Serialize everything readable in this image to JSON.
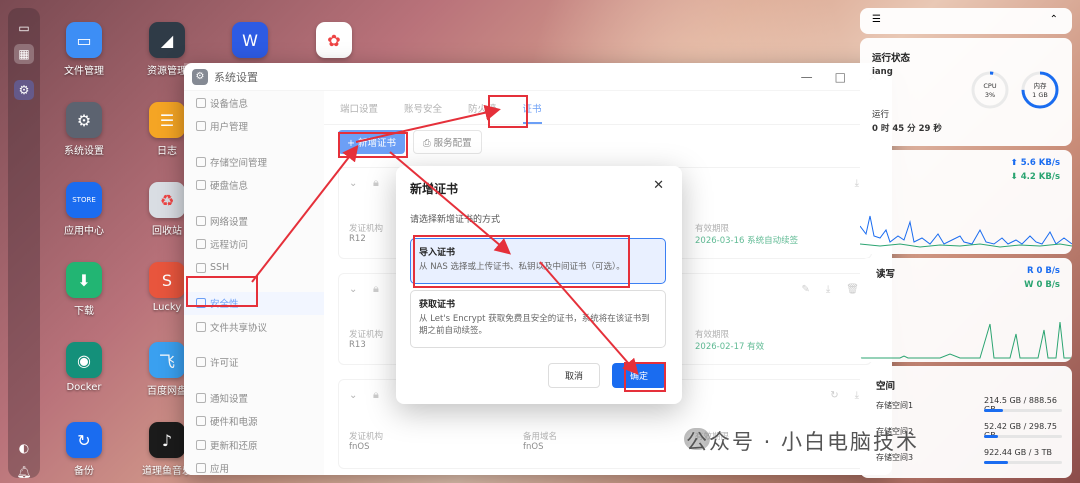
{
  "desktop": {
    "icons": [
      {
        "label": "文件管理",
        "glyph": "▭",
        "color": "#3d8ef5"
      },
      {
        "label": "资源管理",
        "glyph": "◢",
        "color": "#2f3b47"
      },
      {
        "label": "W",
        "glyph": "W",
        "color": "#2d5be3"
      },
      {
        "label": "",
        "glyph": "✿",
        "color": "#ffffff"
      },
      {
        "label": "系统设置",
        "glyph": "⚙",
        "color": "#5c6370"
      },
      {
        "label": "日志",
        "glyph": "☰",
        "color": "#f5a524"
      },
      {
        "label": "应用中心",
        "glyph": "STORE",
        "color": "#1a6cf0"
      },
      {
        "label": "回收站",
        "glyph": "♻",
        "color": "#d9dde3"
      },
      {
        "label": "下载",
        "glyph": "⬇",
        "color": "#22b573"
      },
      {
        "label": "Lucky",
        "glyph": "S",
        "color": "#e8553d"
      },
      {
        "label": "Docker",
        "glyph": "◉",
        "color": "#14907a"
      },
      {
        "label": "百度网盘",
        "glyph": "飞",
        "color": "#3aa0f0"
      },
      {
        "label": "备份",
        "glyph": "↻",
        "color": "#1a6cf0"
      },
      {
        "label": "道理鱼音乐",
        "glyph": "♪",
        "color": "#1b1b1b"
      }
    ]
  },
  "window": {
    "title": "系统设置",
    "controls": {
      "minimize": "—",
      "maximize": "□",
      "close": "✕"
    },
    "sidebar": [
      {
        "label": "设备信息",
        "icon": "device-icon"
      },
      {
        "label": "用户管理",
        "icon": "user-icon"
      },
      {
        "label": "存储空间管理",
        "icon": "storage-icon"
      },
      {
        "label": "硬盘信息",
        "icon": "disk-icon"
      },
      {
        "label": "网络设置",
        "icon": "network-icon"
      },
      {
        "label": "远程访问",
        "icon": "remote-icon"
      },
      {
        "label": "SSH",
        "icon": "ssh-icon"
      },
      {
        "label": "安全性",
        "icon": "shield-icon",
        "active": true
      },
      {
        "label": "文件共享协议",
        "icon": "share-icon"
      },
      {
        "label": "许可证",
        "icon": "license-icon"
      },
      {
        "label": "通知设置",
        "icon": "bell-icon"
      },
      {
        "label": "硬件和电源",
        "icon": "power-icon"
      },
      {
        "label": "更新和还原",
        "icon": "update-icon"
      },
      {
        "label": "应用",
        "icon": "app-icon"
      }
    ],
    "tabs": [
      "端口设置",
      "账号安全",
      "防火墙",
      "证书"
    ],
    "toolbar": {
      "add_cert": "+ 新增证书",
      "service_config": "服务配置"
    },
    "cards": [
      {
        "issuer_label": "发证机构",
        "issuer": "R12",
        "validity_label": "有效期限",
        "validity": "2026-03-16 系统自动续签"
      },
      {
        "issuer_label": "发证机构",
        "issuer": "R13",
        "validity_label": "有效期限",
        "validity": "2026-02-17 有效"
      },
      {
        "issuer_label": "发证机构",
        "issuer": "fnOS",
        "domain_label": "备用域名",
        "domain": "fnOS",
        "validity_label": "有效期限"
      }
    ]
  },
  "modal": {
    "title": "新增证书",
    "subtitle": "请选择新增证书的方式",
    "options": [
      {
        "title": "导入证书",
        "desc": "从 NAS 选择或上传证书、私钥以及中间证书（可选）。"
      },
      {
        "title": "获取证书",
        "desc": "从 Let's Encrypt 获取免费且安全的证书，系统将在该证书到期之前自动续签。"
      }
    ],
    "cancel": "取消",
    "confirm": "确定"
  },
  "panel": {
    "status": {
      "title": "运行状态",
      "host": "iang",
      "runtime_label": "运行",
      "runtime": "0 时 45 分 29 秒",
      "cpu_label": "CPU",
      "cpu_value": "3%",
      "cpu_percent": 3,
      "mem_label": "内存",
      "mem_value": "1 GB",
      "mem_percent": 75
    },
    "network": {
      "up": "⬆ 5.6 KB/s",
      "down": "⬇ 4.2 KB/s"
    },
    "disk_io": {
      "title": "读写",
      "read": "R 0 B/s",
      "write": "W 0 B/s"
    },
    "storage": {
      "title": "空间",
      "items": [
        {
          "name": "存储空间1",
          "usage": "214.5 GB / 888.56 GB",
          "fraction": 0.24
        },
        {
          "name": "存储空间2",
          "usage": "52.42 GB / 298.75 GB",
          "fraction": 0.18
        },
        {
          "name": "存储空间3",
          "usage": "922.44 GB / 3 TB",
          "fraction": 0.31
        }
      ]
    }
  },
  "watermark": "公众号 · 小白电脑技术",
  "colors": {
    "accent": "#3b7ff3",
    "annotation": "#e5303a",
    "success": "#2ba471"
  }
}
